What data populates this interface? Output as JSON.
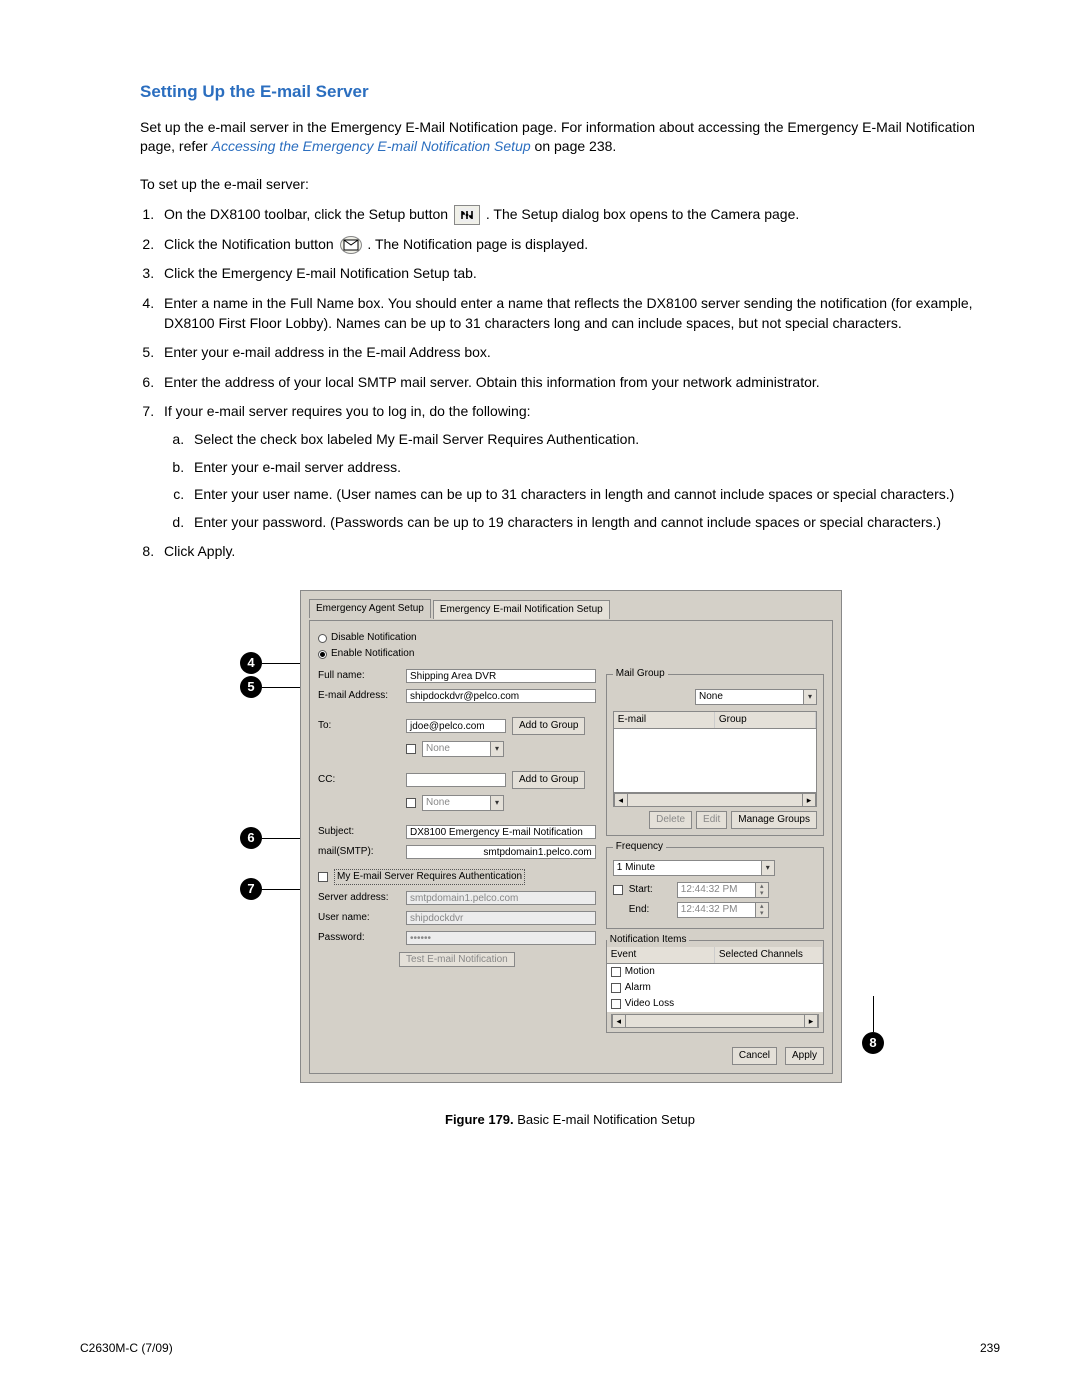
{
  "title": "Setting Up the E-mail Server",
  "intro_a": "Set up the e-mail server in the Emergency E-Mail Notification page. For information about accessing the Emergency E-Mail Notification page, refer ",
  "intro_link": "Accessing the Emergency E-mail Notification Setup",
  "intro_b": " on page 238.",
  "pre_list": "To set up the e-mail server:",
  "steps": {
    "s1a": "On the DX8100 toolbar, click the Setup button ",
    "s1b": ". The Setup dialog box opens to the Camera page.",
    "s2a": "Click the Notification button ",
    "s2b": ". The Notification page is displayed.",
    "s3": "Click the Emergency E-mail Notification Setup tab.",
    "s4": "Enter a name in the Full Name box. You should enter a name that reflects the DX8100 server sending the notification (for example, DX8100 First Floor Lobby). Names can be up to 31 characters long and can include spaces, but not special characters.",
    "s5": "Enter your e-mail address in the E-mail Address box.",
    "s6": "Enter the address of your local SMTP mail server. Obtain this information from your network administrator.",
    "s7": "If your e-mail server requires you to log in, do the following:",
    "s7a": "Select the check box labeled My E-mail Server Requires Authentication.",
    "s7b": "Enter your e-mail server address.",
    "s7c": "Enter your user name. (User names can be up to 31 characters in length and cannot include spaces or special characters.)",
    "s7d": "Enter your password. (Passwords can be up to 19 characters in length and cannot include spaces or special characters.)",
    "s8": "Click Apply."
  },
  "shot": {
    "tabs": {
      "agent": "Emergency Agent Setup",
      "email": "Emergency E-mail Notification Setup"
    },
    "radio_disable": "Disable Notification",
    "radio_enable": "Enable Notification",
    "labels": {
      "full_name": "Full name:",
      "email_addr": "E-mail Address:",
      "to": "To:",
      "cc": "CC:",
      "subject": "Subject:",
      "smtp": "mail(SMTP):",
      "auth_chk": "My E-mail Server Requires Authentication",
      "server_addr": "Server address:",
      "user": "User name:",
      "pass": "Password:"
    },
    "values": {
      "full_name": "Shipping Area DVR",
      "email_addr": "shipdockdvr@pelco.com",
      "to": "jdoe@pelco.com",
      "to_group": "None",
      "cc": "",
      "cc_group": "None",
      "subject": "DX8100 Emergency E-mail Notification",
      "smtp": "smtpdomain1.pelco.com",
      "server_addr": "smtpdomain1.pelco.com",
      "user": "shipdockdvr",
      "pass": "••••••"
    },
    "buttons": {
      "add_to_group": "Add to Group",
      "test": "Test E-mail Notification",
      "delete": "Delete",
      "edit": "Edit",
      "manage": "Manage Groups",
      "cancel": "Cancel",
      "apply": "Apply"
    },
    "mail_group": {
      "legend": "Mail Group",
      "select_val": "None",
      "col_email": "E-mail",
      "col_group": "Group"
    },
    "frequency": {
      "legend": "Frequency",
      "interval": "1 Minute",
      "start_lbl": "Start:",
      "end_lbl": "End:",
      "start_val": "12:44:32 PM",
      "end_val": "12:44:32 PM"
    },
    "notif_items": {
      "legend": "Notification Items",
      "col_event": "Event",
      "col_sel": "Selected Channels",
      "motion": "Motion",
      "alarm": "Alarm",
      "video_loss": "Video Loss"
    }
  },
  "callouts": {
    "c4": "4",
    "c5": "5",
    "c6": "6",
    "c7": "7",
    "c8": "8"
  },
  "figure": {
    "label": "Figure 179.",
    "text": "  Basic E-mail Notification Setup"
  },
  "footer": {
    "left": "C2630M-C (7/09)",
    "right": "239"
  }
}
